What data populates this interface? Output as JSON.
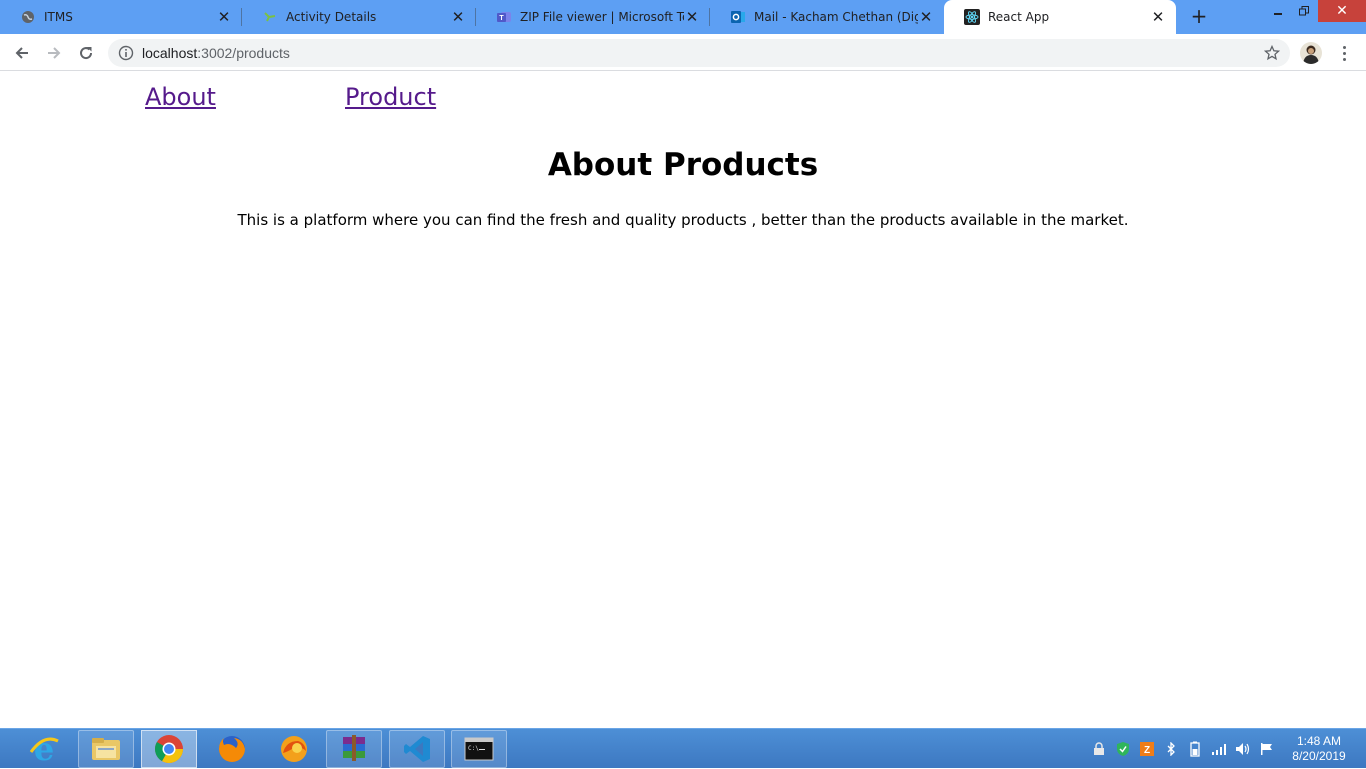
{
  "browser": {
    "tabs": [
      {
        "title": "ITMS",
        "icon": "globe-icon"
      },
      {
        "title": "Activity Details",
        "icon": "activity-icon"
      },
      {
        "title": "ZIP File viewer | Microsoft Teams",
        "icon": "teams-icon"
      },
      {
        "title": "Mail - Kacham Chethan (Digital)",
        "icon": "outlook-icon"
      },
      {
        "title": "React App",
        "icon": "react-icon",
        "active": true
      }
    ],
    "address": {
      "host": "localhost",
      "path": ":3002/products"
    }
  },
  "page": {
    "nav": {
      "about": "About",
      "product": "Product"
    },
    "heading": "About Products",
    "description": "This is a platform where you can find the fresh and quality products , better than the products available in the market."
  },
  "taskbar": {
    "apps": [
      "internet-explorer-icon",
      "file-explorer-icon",
      "chrome-icon",
      "firefox-icon",
      "firefox-alt-icon",
      "winrar-icon",
      "vscode-icon",
      "command-prompt-icon"
    ],
    "clock": {
      "time": "1:48 AM",
      "date": "8/20/2019"
    }
  },
  "colors": {
    "tabstrip": "#5d9ff3",
    "link": "#551a8b",
    "taskbar": "#3d78c1"
  }
}
